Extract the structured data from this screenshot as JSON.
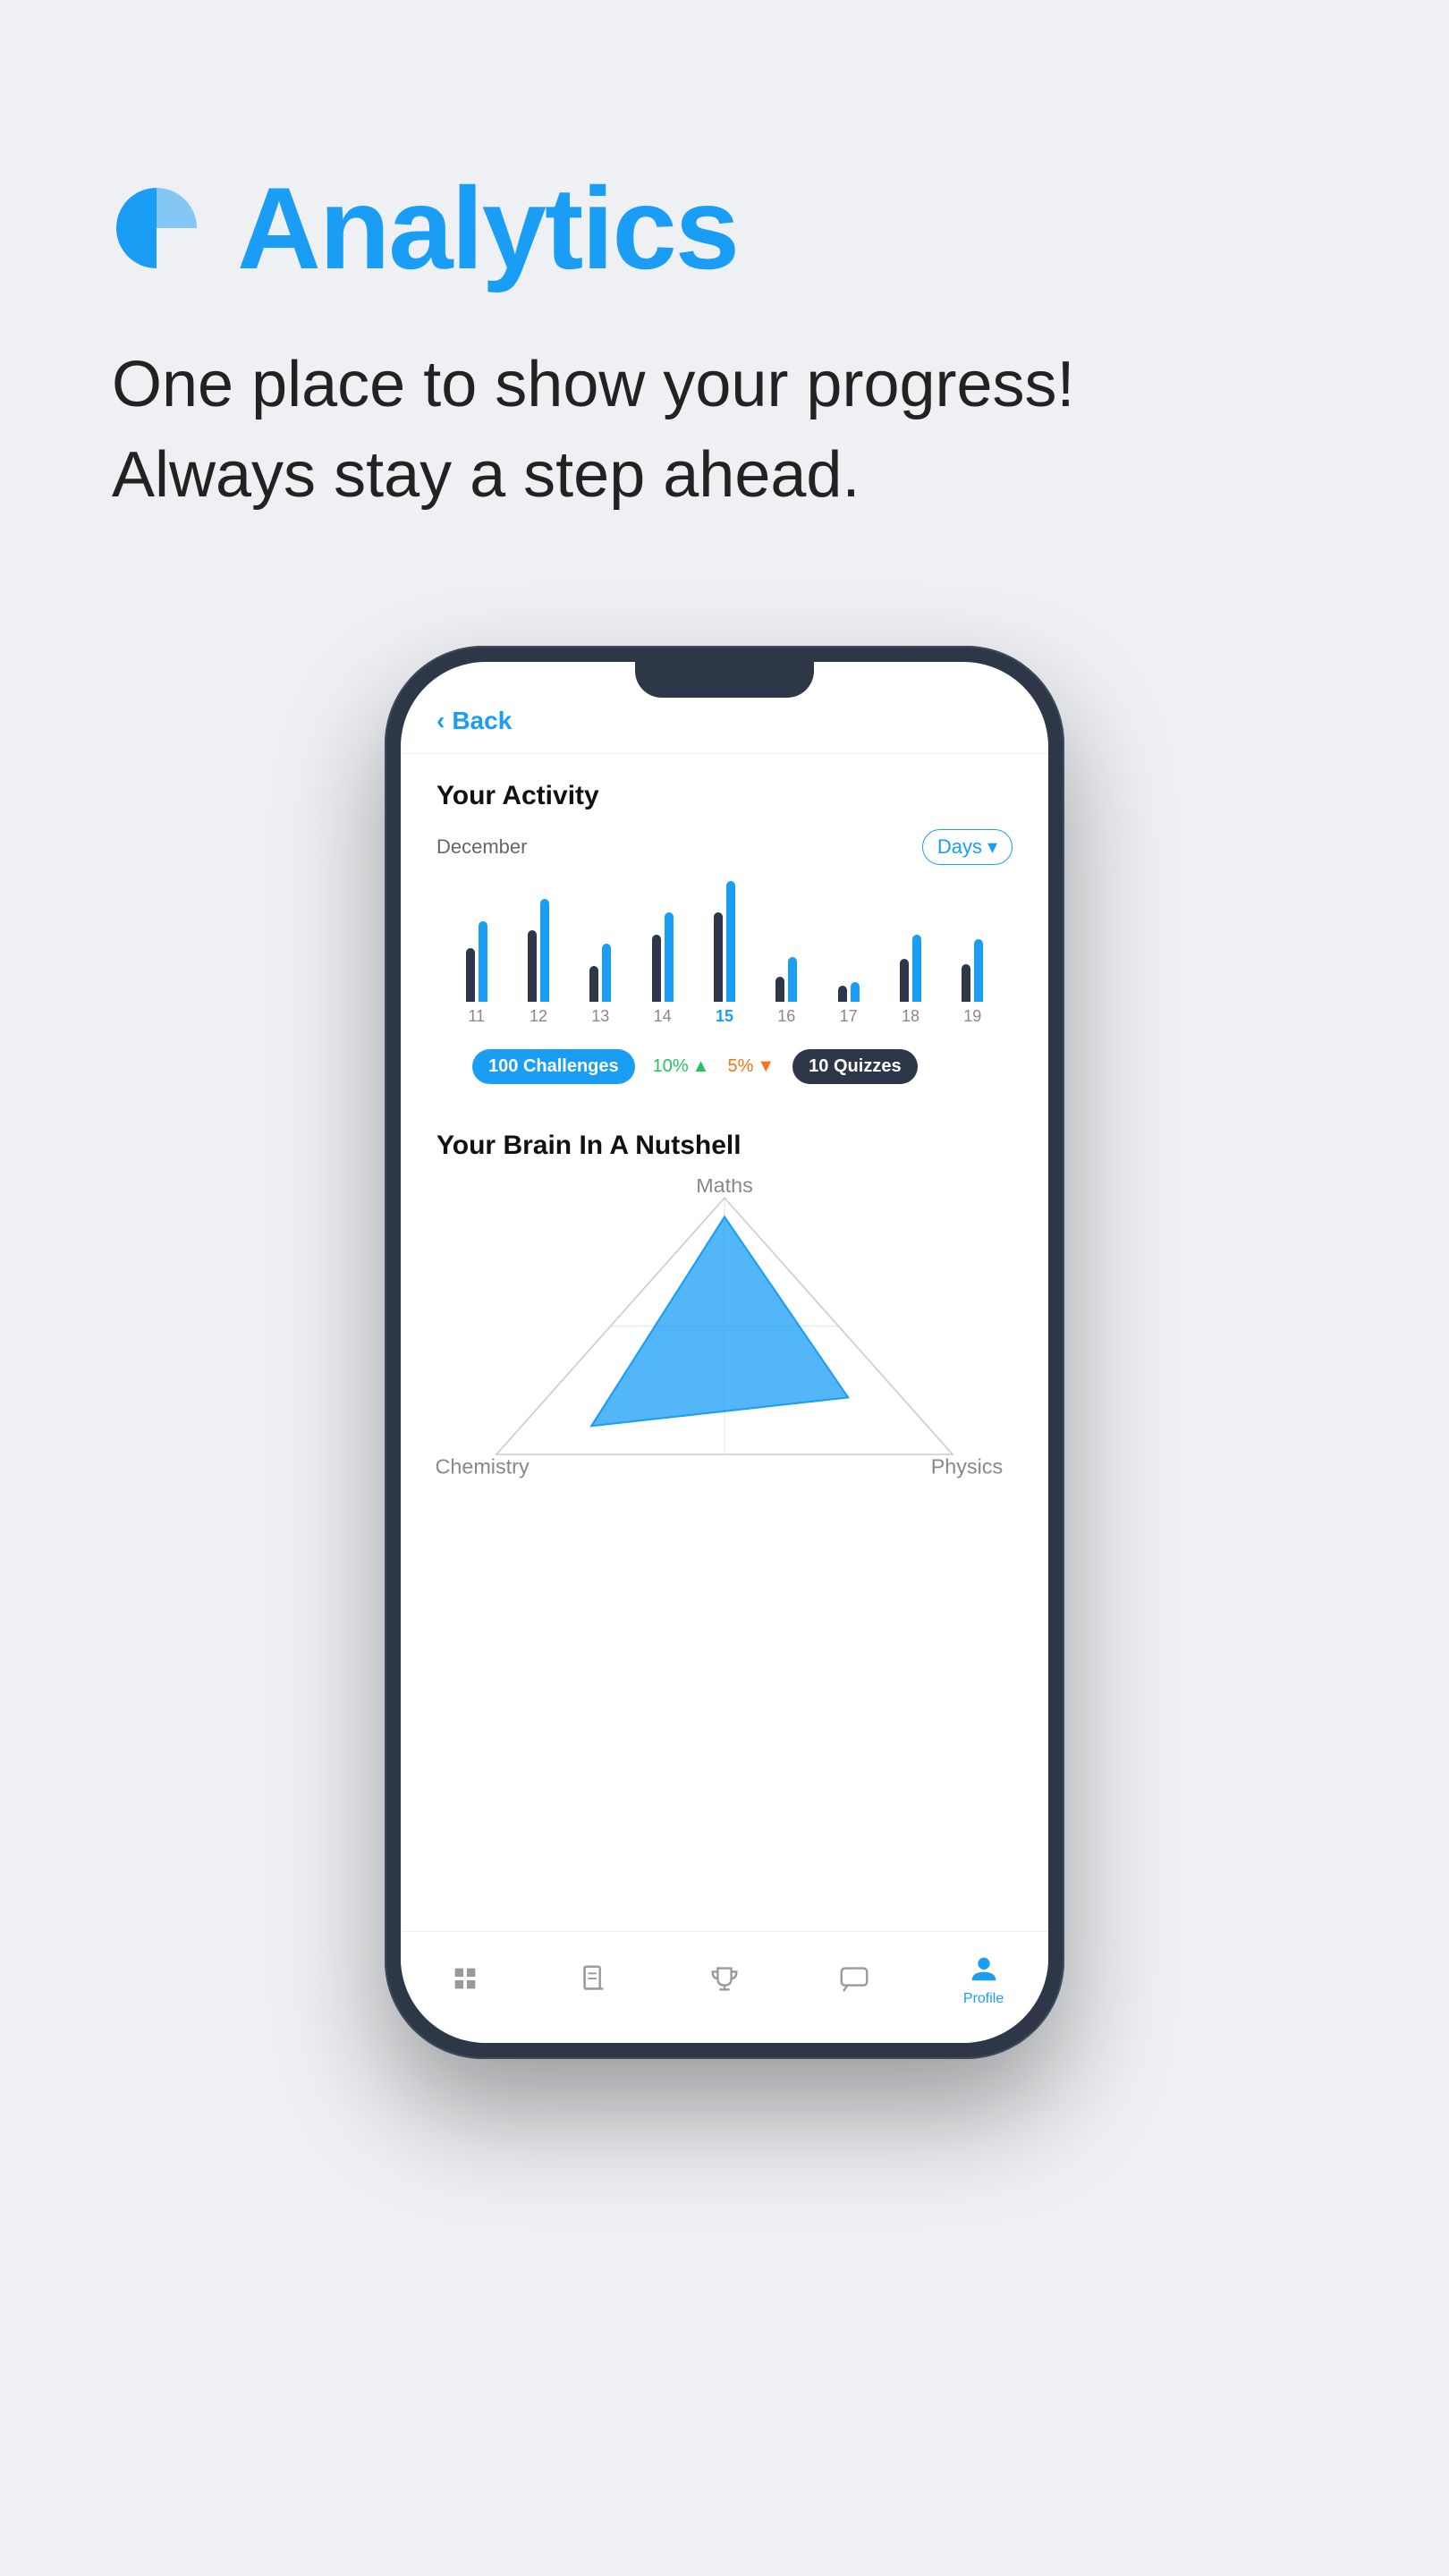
{
  "header": {
    "title": "Analytics",
    "subtitle_line1": "One place to show your progress!",
    "subtitle_line2": "Always stay a step ahead.",
    "icon": "pie-chart-icon"
  },
  "phone": {
    "back_label": "Back",
    "screen": {
      "activity": {
        "title": "Your Activity",
        "month": "December",
        "filter": "Days",
        "bars": [
          {
            "day": "11",
            "heights": [
              60,
              90
            ],
            "active": false
          },
          {
            "day": "12",
            "heights": [
              80,
              110
            ],
            "active": false
          },
          {
            "day": "13",
            "heights": [
              40,
              70
            ],
            "active": false
          },
          {
            "day": "14",
            "heights": [
              70,
              95
            ],
            "active": false
          },
          {
            "day": "15",
            "heights": [
              100,
              130
            ],
            "active": true
          },
          {
            "day": "16",
            "heights": [
              30,
              55
            ],
            "active": false
          },
          {
            "day": "17",
            "heights": [
              20,
              25
            ],
            "active": false
          },
          {
            "day": "18",
            "heights": [
              50,
              80
            ],
            "active": false
          },
          {
            "day": "19",
            "heights": [
              45,
              75
            ],
            "active": false
          }
        ],
        "stats": {
          "challenges": {
            "value": "100",
            "label": "Challenges"
          },
          "change_up": "10%",
          "change_down": "5%",
          "quizzes": {
            "value": "10",
            "label": "Quizzes"
          }
        }
      },
      "brain": {
        "title": "Your Brain In A Nutshell",
        "labels": {
          "top": "Maths",
          "bottom_left": "Chemistry",
          "bottom_right": "Physics"
        }
      },
      "nav": {
        "items": [
          {
            "label": "Home",
            "icon": "home-icon",
            "active": false
          },
          {
            "label": "Lessons",
            "icon": "book-icon",
            "active": false
          },
          {
            "label": "Trophy",
            "icon": "trophy-icon",
            "active": false
          },
          {
            "label": "Chat",
            "icon": "chat-icon",
            "active": false
          },
          {
            "label": "Profile",
            "icon": "profile-icon",
            "active": true
          }
        ]
      }
    }
  },
  "colors": {
    "accent": "#1a9ef5",
    "dark": "#2d3748",
    "background": "#eef0f3",
    "text_primary": "#111",
    "text_secondary": "#666"
  }
}
